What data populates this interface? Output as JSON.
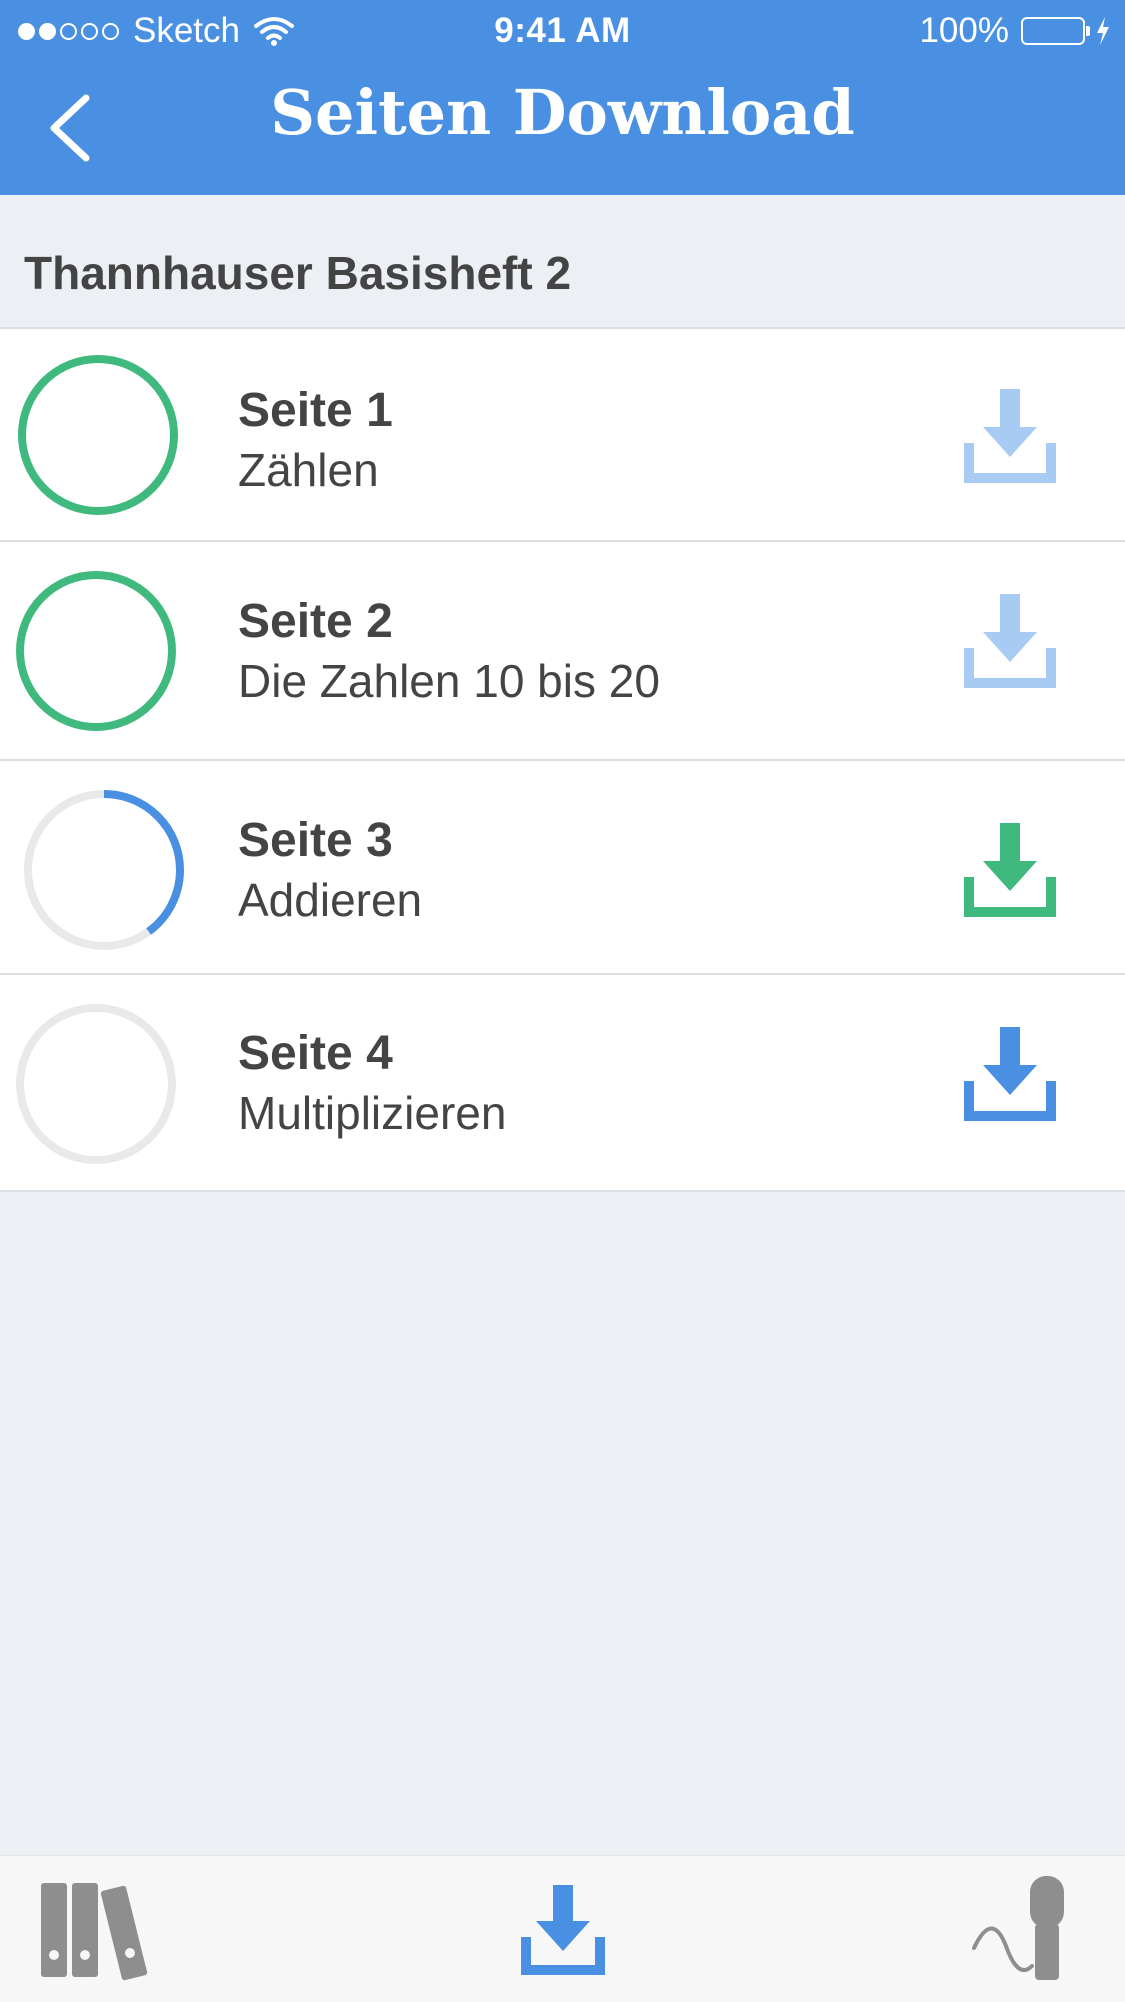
{
  "status_bar": {
    "carrier": "Sketch",
    "time": "9:41 AM",
    "battery": "100%",
    "battery_level_percent": 100
  },
  "nav": {
    "title": "Seiten Download",
    "back_icon": "chevron-left-icon"
  },
  "section": {
    "title": "Thannhauser Basisheft 2"
  },
  "pages": [
    {
      "title": "Seite 1",
      "subtitle": "Zählen",
      "progress_percent": 100,
      "state": "downloaded",
      "icon": "download-icon"
    },
    {
      "title": "Seite 2",
      "subtitle": "Die Zahlen 10 bis 20",
      "progress_percent": 100,
      "state": "downloaded",
      "icon": "download-icon"
    },
    {
      "title": "Seite 3",
      "subtitle": "Addieren",
      "progress_percent": 40,
      "state": "downloading",
      "icon": "download-icon"
    },
    {
      "title": "Seite 4",
      "subtitle": "Multiplizieren",
      "progress_percent": 0,
      "state": "not-downloaded",
      "icon": "download-icon"
    }
  ],
  "tabbar": {
    "items": [
      {
        "icon": "library-icon"
      },
      {
        "icon": "download-icon",
        "active": true
      },
      {
        "icon": "microphone-icon"
      }
    ]
  },
  "colors": {
    "accent": "#4A90E2",
    "success": "#3FB97D",
    "light_accent": "#A8CBF3",
    "ring_track": "#E9E9E9",
    "text": "#444444",
    "background": "#ECF0F4"
  }
}
